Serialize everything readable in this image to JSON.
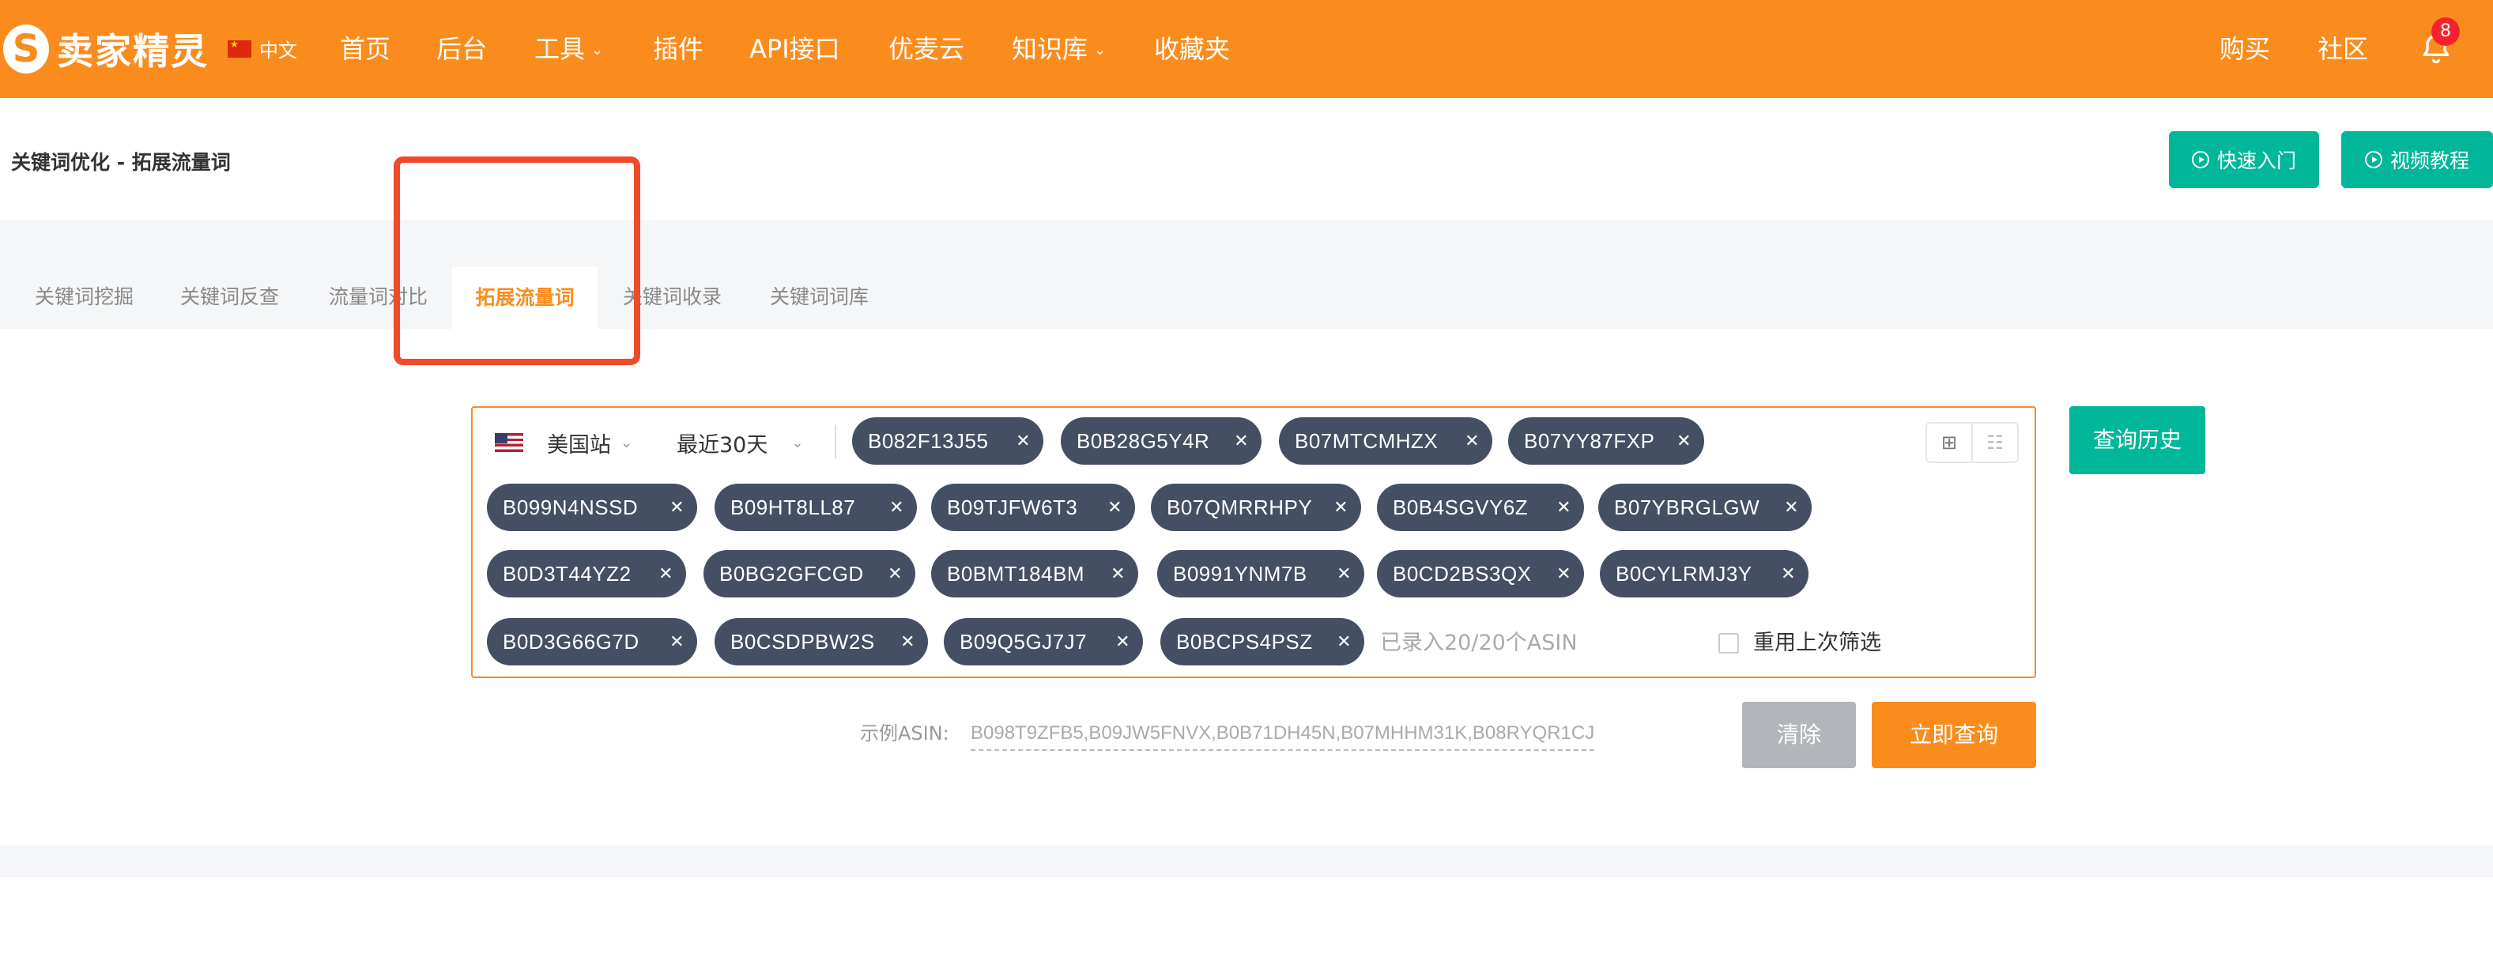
{
  "brand": {
    "name": "卖家精灵"
  },
  "language": {
    "label": "中文"
  },
  "nav": {
    "home": "首页",
    "backend": "后台",
    "tools": "工具",
    "plugins": "插件",
    "api": "API接口",
    "youmai": "优麦云",
    "knowledge": "知识库",
    "favorites": "收藏夹",
    "buy": "购买",
    "community": "社区",
    "notification_count": "8"
  },
  "page": {
    "breadcrumb": "关键词优化 - 拓展流量词",
    "quick_start": "快速入门",
    "video_tutorial": "视频教程"
  },
  "tabs": {
    "mining": "关键词挖掘",
    "reverse": "关键词反查",
    "compare": "流量词对比",
    "extend": "拓展流量词",
    "collect": "关键词收录",
    "library": "关键词词库"
  },
  "search": {
    "site": "美国站",
    "period": "最近30天",
    "asins": [
      "B082F13J55",
      "B0B28G5Y4R",
      "B07MTCMHZX",
      "B07YY87FXP",
      "B099N4NSSD",
      "B09HT8LL87",
      "B09TJFW6T3",
      "B07QMRRHPY",
      "B0B4SGVY6Z",
      "B07YBRGLGW",
      "B0D3T44YZ2",
      "B0BG2GFCGD",
      "B0BMT184BM",
      "B0991YNM7B",
      "B0CD2BS3QX",
      "B0CYLRMJ3Y",
      "B0D3G66G7D",
      "B0CSDPBW2S",
      "B09Q5GJ7J7",
      "B0BCPS4PSZ"
    ],
    "count_text": "已录入20/20个ASIN",
    "reuse_filter": "重用上次筛选",
    "history_button": "查询历史",
    "example_label": "示例ASIN:",
    "example_value": "B098T9ZFB5,B09JW5FNVX,B0B71DH45N,B07MHHM31K,B08RYQR1CJ",
    "clear_button": "清除",
    "query_button": "立即查询"
  },
  "colors": {
    "brand_orange": "#fa8c1e",
    "accent_green": "#00b79a",
    "tag_dark": "#454f63",
    "highlight_red": "#f04a2b"
  }
}
